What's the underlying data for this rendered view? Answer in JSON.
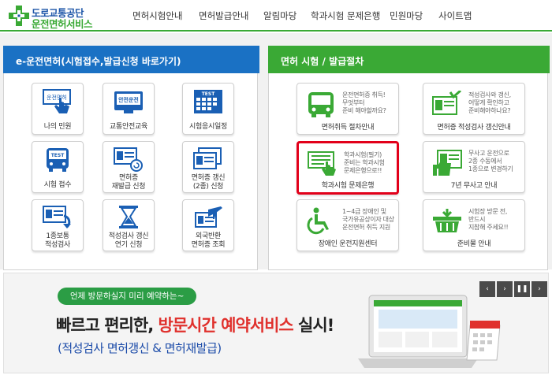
{
  "header": {
    "logo_line1": "도로교통공단",
    "logo_line2": "운전면허서비스",
    "nav": [
      "면허시험안내",
      "면허발급안내",
      "알림마당",
      "학과시험 문제은행",
      "민원마당",
      "사이트맵"
    ]
  },
  "left_panel": {
    "title": "e-운전면허(시험접수,발급신청 바로가기)",
    "tiles": [
      {
        "label": "나의 민원",
        "icon_text": "운전면허"
      },
      {
        "label": "교통안전교육",
        "icon_text": "안전운전"
      },
      {
        "label": "시험응시일정",
        "icon_text": "TEST"
      },
      {
        "label": "시험 접수",
        "icon_text": "TEST"
      },
      {
        "label1": "면허증",
        "label2": "재발급 신청"
      },
      {
        "label1": "면허증 갱신",
        "label2": "(2종) 신청"
      },
      {
        "label1": "1종보통",
        "label2": "적성검사"
      },
      {
        "label1": "적성검사 갱신",
        "label2": "연기 신청"
      },
      {
        "label1": "외국반환",
        "label2": "면허증 조회"
      }
    ]
  },
  "right_panel": {
    "title": "면허 시험 / 발급절차",
    "tiles": [
      {
        "label": "면허취득 절차안내",
        "desc": "운전면허증 취득!\n무엇부터\n준비 해야할까요?"
      },
      {
        "label": "면허증 적성검사 갱신안내",
        "desc": "적성검사와 갱신,\n어떻게 확인하고\n준비해야하나요?"
      },
      {
        "label": "학과시험 문제은행",
        "desc": "학과시험(필기)\n준비는 학과시험\n문제은행으로!!"
      },
      {
        "label": "7년 무사고 안내",
        "desc": "무사고 운전으로\n2종 수동에서\n1종으로 변경하기"
      },
      {
        "label": "장애인 운전지원센터",
        "desc": "1~4급 장애인 및\n국가유공상이자 대상\n운전면허 취득 지원"
      },
      {
        "label": "준비물 안내",
        "desc": "시험장 방문 전,\n반드시\n지참해 주세요!!"
      }
    ]
  },
  "banner": {
    "pill": "언제 방문하실지 미리 예약하는~",
    "headline_pre": "빠르고 편리한, ",
    "headline_red": "방문시간 예약서비스",
    "headline_post": " 실시!",
    "sub": "(적성검사 면허갱신 & 면허재발급)",
    "controls": [
      "‹",
      "›",
      "❚❚",
      "›"
    ]
  },
  "colors": {
    "green": "#3aa935",
    "blue": "#1a71c4",
    "red": "#e2001a"
  }
}
